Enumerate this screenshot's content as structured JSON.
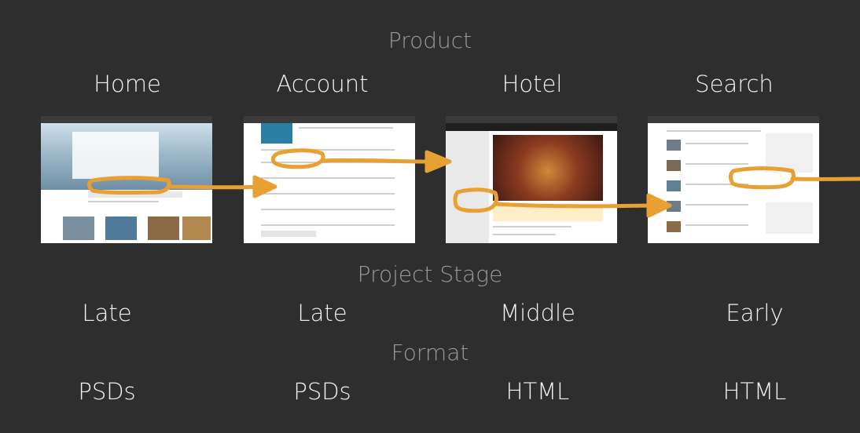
{
  "sections": {
    "product": "Product",
    "stage": "Project Stage",
    "format": "Format"
  },
  "products": [
    {
      "name": "Home",
      "stage": "Late",
      "format": "PSDs"
    },
    {
      "name": "Account",
      "stage": "Late",
      "format": "PSDs"
    },
    {
      "name": "Hotel",
      "stage": "Middle",
      "format": "HTML"
    },
    {
      "name": "Search",
      "stage": "Early",
      "format": "HTML"
    }
  ],
  "colors": {
    "background": "#2e2e2e",
    "section_text": "#9a9a9a",
    "item_text": "#f2f2f2",
    "arrow": "#e8a032"
  }
}
